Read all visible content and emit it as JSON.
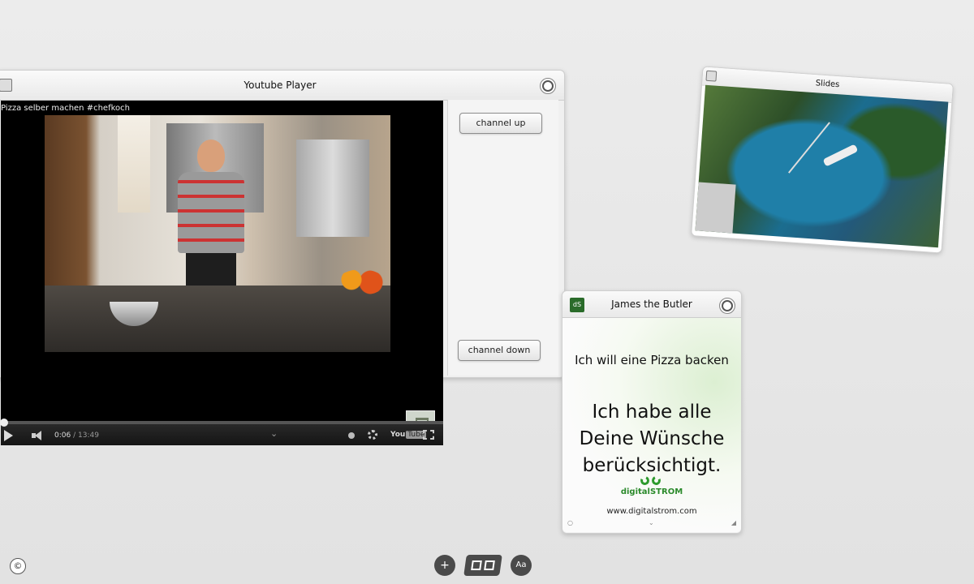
{
  "youtube_widget": {
    "title": "Youtube Player",
    "video_caption": "Pizza selber machen #chefkoch",
    "current_time": "0:06",
    "duration": "/ 13:49",
    "progress_fraction": 0.0075,
    "yt_logo_you": "You",
    "yt_logo_tube": "Tube",
    "channel_up_label": "channel up",
    "channel_down_label": "channel down"
  },
  "slides_widget": {
    "title": "Slides"
  },
  "butler_widget": {
    "title": "James the Butler",
    "app_icon_label": "dS",
    "line1": "Ich will eine Pizza backen",
    "line2": "Ich habe alle Deine Wünsche berücksichtigt.",
    "brand": "digitalSTROM",
    "url": "www.digitalstrom.com"
  },
  "toolbar": {
    "add_label": "+",
    "font_label": "Aa",
    "copyright_label": "©"
  },
  "colors": {
    "background": "#e8e8e8",
    "brand_green": "#2e9a2e",
    "toolbar_button": "#4a4a4a"
  }
}
